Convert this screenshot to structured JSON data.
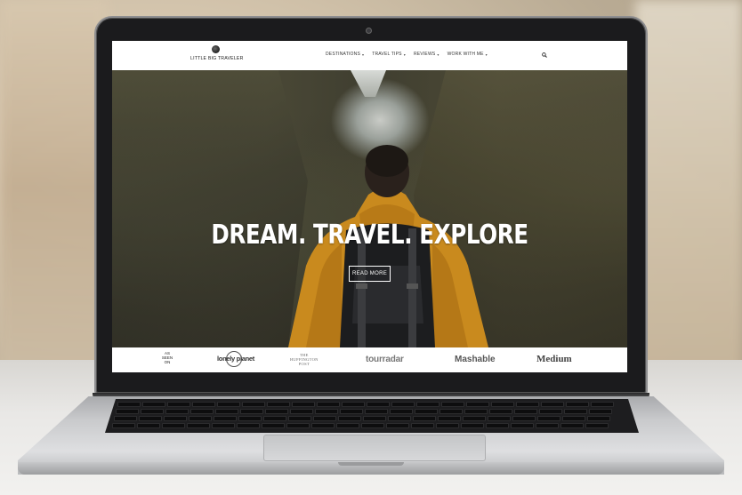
{
  "site": {
    "logo_text": "LITTLE BIG TRAVELER"
  },
  "nav": {
    "items": [
      {
        "label": "DESTINATIONS"
      },
      {
        "label": "TRAVEL TIPS"
      },
      {
        "label": "REVIEWS"
      },
      {
        "label": "WORK WITH ME"
      }
    ],
    "search_icon": "search-icon"
  },
  "hero": {
    "title": "DREAM. TRAVEL. EXPLORE",
    "button_label": "READ MORE"
  },
  "press": {
    "as_seen_on": [
      "AS",
      "SEEN",
      "ON"
    ],
    "logos": {
      "lonely_planet": "lonely planet",
      "huffington_line1": "THE",
      "huffington_line2": "HUFFINGTON",
      "huffington_line3": "POST",
      "tourradar": "tourradar",
      "mashable": "Mashable",
      "medium": "Medium"
    }
  },
  "colors": {
    "jacket": "#c98a1e",
    "hero_text": "#ffffff",
    "header_bg": "#ffffff"
  }
}
